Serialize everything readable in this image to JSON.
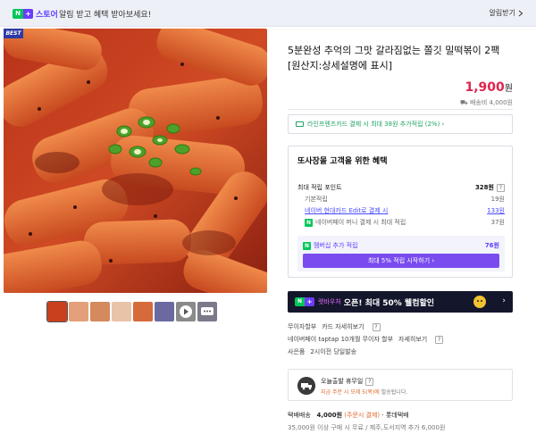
{
  "banner": {
    "badge_n": "N",
    "badge_plus": "+",
    "brand": "스토어",
    "message": "알림 받고 혜택 받아보세요!",
    "alarm_button": "알림받기",
    "alarm_icon": "chevron-right-icon"
  },
  "gallery": {
    "best_tag": "BEST",
    "thumbnails": [
      {
        "name": "thumb-1",
        "color": "#c9401e"
      },
      {
        "name": "thumb-2",
        "color": "#e3a07a"
      },
      {
        "name": "thumb-3",
        "color": "#d48a5c"
      },
      {
        "name": "thumb-4",
        "color": "#e9c3a8"
      },
      {
        "name": "thumb-5",
        "color": "#d56a3a"
      },
      {
        "name": "thumb-6",
        "color": "#6a6aa0"
      },
      {
        "name": "thumb-7-video",
        "color": "#8a8a8a"
      },
      {
        "name": "thumb-8-chat",
        "color": "#7a7a8a"
      }
    ]
  },
  "product": {
    "title_line1": "5분완성 추억의 그맛 갈라짐없는 쫄깃 밀떡볶이 2팩",
    "title_line2": "[원산지:상세설명에 표시]",
    "price_value": "1,900",
    "price_unit": "원",
    "shipping_fee": "배송비 4,000원"
  },
  "card_promo": "라인프렌즈카드 결제 시 최대 38원 추가적립 (2%) ›",
  "benefits": {
    "heading": "또사장몰 고객을 위한 혜택",
    "max_points_label": "최대 적립 포인트",
    "max_points_value": "328원",
    "base_label": "기본적립",
    "base_value": "19원",
    "card_label": "네이버 현대카드 Edit로 결제 시",
    "card_value": "133원",
    "money_label": "네이버페이 머니 결제 시 최대 적립",
    "money_value": "37원",
    "member_label": "멤버십 추가 적립",
    "member_value": "76원",
    "member_button": "최대 5% 적립 시작하기 ›"
  },
  "voucher": {
    "name": "렛바우처",
    "text": "오픈! 최대 50% 웰컴할인",
    "arrow": "›"
  },
  "payment_info": {
    "installment_label": "무이자할부",
    "installment_link": "카드 자세히보기",
    "taptap_label": "네이버페이 taptap 10개월 무이자 할부",
    "taptap_link": "자세히보기",
    "gift_label": "사은품",
    "gift_value": "2시이전 당일발송"
  },
  "delivery": {
    "title": "오늘출발 휴무일",
    "sub_highlight": "지금 주문 시 모레 5(목)에",
    "sub_rest": "발송됩니다."
  },
  "shipping": {
    "method": "택배배송",
    "fee": "4,000원",
    "condition": "(주문시 결제)",
    "carrier": "· 롯데택배",
    "note": "35,000원 이상 구매 시 무료 / 제주,도서지역 추가 6,000원"
  }
}
